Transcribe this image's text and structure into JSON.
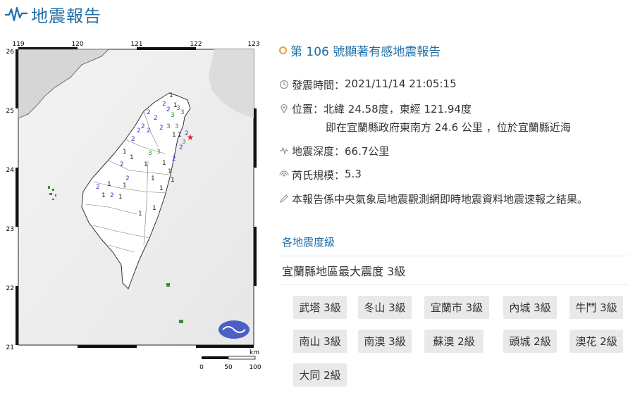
{
  "header": {
    "title": "地震報告",
    "icon": "seismograph-icon",
    "accent": "#1f6fa8"
  },
  "map": {
    "top_ticks": [
      "119",
      "120",
      "121",
      "122",
      "123"
    ],
    "left_ticks": [
      "26",
      "25",
      "24",
      "23",
      "22",
      "21"
    ],
    "scale_unit": "km",
    "scale_labels": [
      "0",
      "50",
      "100"
    ],
    "epicenter_color": "#e02020",
    "intensity_marks": [
      {
        "v": "1",
        "c": "#222"
      },
      {
        "v": "1",
        "c": "#222"
      },
      {
        "v": "2",
        "c": "#3b3bd0"
      },
      {
        "v": "2",
        "c": "#3b3bd0"
      },
      {
        "v": "3",
        "c": "#2a9a2a"
      },
      {
        "v": "3",
        "c": "#2a9a2a"
      },
      {
        "v": "3",
        "c": "#2a9a2a"
      },
      {
        "v": "2",
        "c": "#3b3bd0"
      },
      {
        "v": "2",
        "c": "#3b3bd0"
      },
      {
        "v": "2",
        "c": "#3b3bd0"
      },
      {
        "v": "3",
        "c": "#2a9a2a"
      },
      {
        "v": "3",
        "c": "#2a9a2a"
      },
      {
        "v": "2",
        "c": "#3b3bd0"
      },
      {
        "v": "2",
        "c": "#3b3bd0"
      },
      {
        "v": "2",
        "c": "#3b3bd0"
      },
      {
        "v": "1",
        "c": "#222"
      },
      {
        "v": "1",
        "c": "#222"
      },
      {
        "v": "2",
        "c": "#3b3bd0"
      },
      {
        "v": "2",
        "c": "#3b3bd0"
      },
      {
        "v": "3",
        "c": "#2a9a2a"
      },
      {
        "v": "3",
        "c": "#2a9a2a"
      },
      {
        "v": "3",
        "c": "#2a9a2a"
      },
      {
        "v": "2",
        "c": "#3b3bd0"
      },
      {
        "v": "1",
        "c": "#222"
      },
      {
        "v": "1",
        "c": "#222"
      },
      {
        "v": "2",
        "c": "#3b3bd0"
      },
      {
        "v": "1",
        "c": "#222"
      },
      {
        "v": "1",
        "c": "#222"
      },
      {
        "v": "2",
        "c": "#3b3bd0"
      },
      {
        "v": "2",
        "c": "#3b3bd0"
      },
      {
        "v": "1",
        "c": "#222"
      },
      {
        "v": "1",
        "c": "#222"
      },
      {
        "v": "2",
        "c": "#3b3bd0"
      },
      {
        "v": "1",
        "c": "#222"
      },
      {
        "v": "1",
        "c": "#222"
      },
      {
        "v": "1",
        "c": "#222"
      },
      {
        "v": "1",
        "c": "#222"
      },
      {
        "v": "2",
        "c": "#3b3bd0"
      },
      {
        "v": "1",
        "c": "#222"
      },
      {
        "v": "1",
        "c": "#222"
      },
      {
        "v": "1",
        "c": "#222"
      },
      {
        "v": "1",
        "c": "#222"
      }
    ]
  },
  "report": {
    "title": "第 106 號顯著有感地震報告",
    "time_label": "發震時間：",
    "time_value": "2021/11/14 21:05:15",
    "location_label": "位置：",
    "location_value": "北緯 24.58度，東經 121.94度",
    "location_detail": "即在宜蘭縣政府東南方 24.6 公里 ，位於宜蘭縣近海",
    "depth_label": "地震深度：",
    "depth_value": "66.7公里",
    "magnitude_label": "芮氏規模：",
    "magnitude_value": "5.3",
    "note": "本報告係中央氣象局地震觀測網即時地震資料地震速報之結果。"
  },
  "intensity": {
    "section_title": "各地震度級",
    "max_line": "宜蘭縣地區最大震度 3級",
    "stations": [
      "武塔 3級",
      "冬山 3級",
      "宜蘭市 3級",
      "內城 3級",
      "牛鬥 3級",
      "南山 3級",
      "南澳 3級",
      "蘇澳 2級",
      "頭城 2級",
      "澳花 2級",
      "大同 2級"
    ]
  }
}
